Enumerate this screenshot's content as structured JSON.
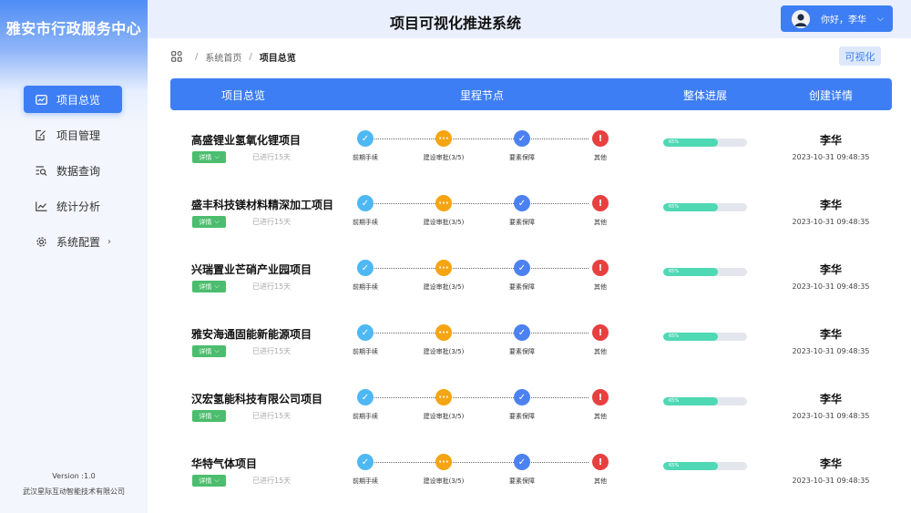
{
  "brand": {
    "title": "雅安市行政服务中心"
  },
  "header": {
    "title": "项目可视化推进系统",
    "user_greeting": "你好，李华"
  },
  "sidebar": {
    "items": [
      {
        "label": "项目总览",
        "icon": "dashboard-icon",
        "active": true
      },
      {
        "label": "项目管理",
        "icon": "edit-doc-icon",
        "active": false
      },
      {
        "label": "数据查询",
        "icon": "search-doc-icon",
        "active": false
      },
      {
        "label": "统计分析",
        "icon": "line-chart-icon",
        "active": false
      },
      {
        "label": "系统配置",
        "icon": "gear-icon",
        "active": false,
        "has_submenu": true
      }
    ],
    "version": "Version :1.0",
    "company": "武汉星际互动智能技术有限公司"
  },
  "breadcrumb": {
    "home": "系统首页",
    "current": "项目总览"
  },
  "actions": {
    "visualize": "可视化"
  },
  "table": {
    "headers": [
      "项目总览",
      "里程节点",
      "整体进展",
      "创建详情"
    ],
    "milestone_labels": [
      "前期手续",
      "建设审批(3/5)",
      "要素保障",
      "其他"
    ],
    "detail_label": "详情",
    "colors": {
      "primary": "#3d7ef4",
      "step1": "#4fb8f2",
      "step2": "#f5a512",
      "step3": "#4c82f0",
      "step4": "#e74040",
      "progress": "#4fd8b4",
      "tag": "#4cbd6e"
    },
    "rows": [
      {
        "name": "高盛锂业氢氧化锂项目",
        "elapsed": "已进行15天",
        "progress": 65,
        "progress_label": "65%",
        "creator": "李华",
        "created": "2023-10-31  09:48:35"
      },
      {
        "name": "盛丰科技镁材料精深加工项目",
        "elapsed": "已进行15天",
        "progress": 65,
        "progress_label": "65%",
        "creator": "李华",
        "created": "2023-10-31  09:48:35"
      },
      {
        "name": "兴瑞置业芒硝产业园项目",
        "elapsed": "已进行15天",
        "progress": 65,
        "progress_label": "65%",
        "creator": "李华",
        "created": "2023-10-31  09:48:35"
      },
      {
        "name": "雅安海通固能新能源项目",
        "elapsed": "已进行15天",
        "progress": 65,
        "progress_label": "65%",
        "creator": "李华",
        "created": "2023-10-31  09:48:35"
      },
      {
        "name": "汉宏氢能科技有限公司项目",
        "elapsed": "已进行15天",
        "progress": 65,
        "progress_label": "65%",
        "creator": "李华",
        "created": "2023-10-31  09:48:35"
      },
      {
        "name": "华特气体项目",
        "elapsed": "已进行15天",
        "progress": 65,
        "progress_label": "65%",
        "creator": "李华",
        "created": "2023-10-31  09:48:35"
      }
    ]
  }
}
